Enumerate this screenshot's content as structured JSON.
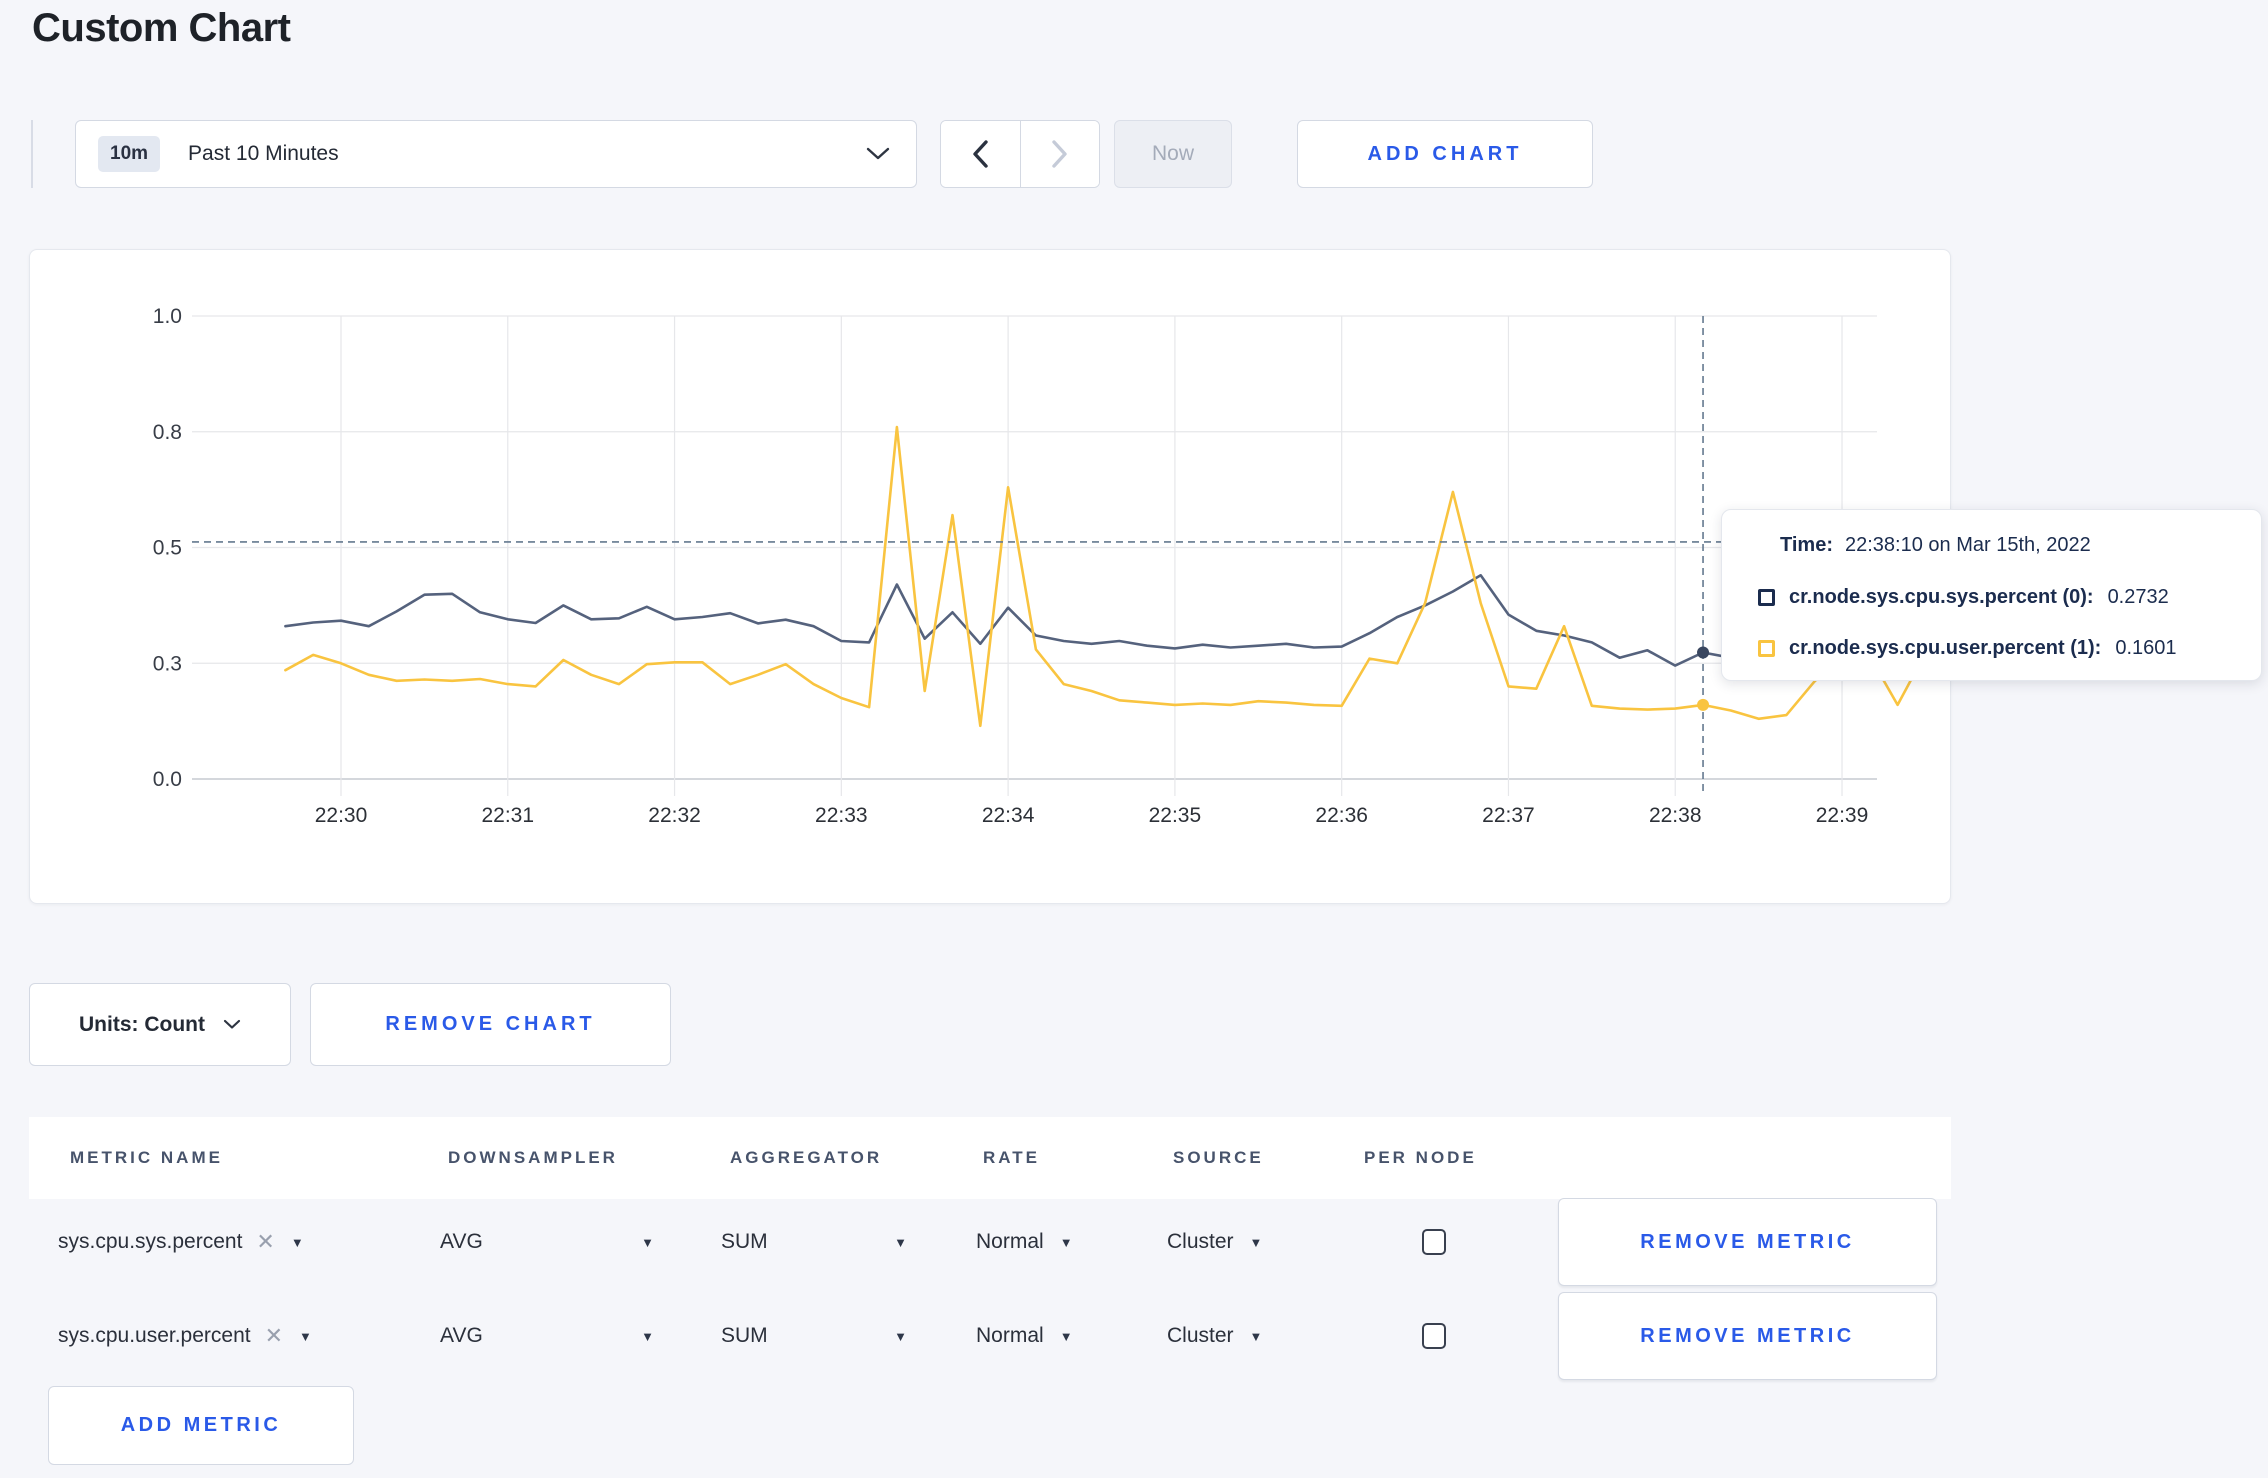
{
  "page": {
    "title": "Custom Chart",
    "accent_blue": "#2a5ae8",
    "background": "#f5f6fa"
  },
  "toolbar": {
    "time_badge": "10m",
    "time_label": "Past 10 Minutes",
    "prev_label": "previous time window",
    "next_label": "next time window",
    "now_label": "Now",
    "add_chart_label": "ADD CHART"
  },
  "chart_data": {
    "type": "line",
    "title": "",
    "xlabel": "",
    "ylabel": "",
    "ylim": [
      0,
      1
    ],
    "grid": true,
    "x_ticks": [
      "22:30",
      "22:31",
      "22:32",
      "22:33",
      "22:34",
      "22:35",
      "22:36",
      "22:37",
      "22:38",
      "22:39"
    ],
    "y_ticks": [
      {
        "value": 0.0,
        "label": "0.0"
      },
      {
        "value": 0.25,
        "label": "0.3"
      },
      {
        "value": 0.5,
        "label": "0.5"
      },
      {
        "value": 0.75,
        "label": "0.8"
      },
      {
        "value": 1.0,
        "label": "1.0"
      }
    ],
    "x_start_offset_sec": -20,
    "x_step_sec": 10,
    "series": [
      {
        "name": "cr.node.sys.cpu.sys.percent (0)",
        "color": "#55627d",
        "values": [
          0.33,
          0.338,
          0.342,
          0.33,
          0.362,
          0.398,
          0.4,
          0.36,
          0.345,
          0.337,
          0.375,
          0.345,
          0.347,
          0.372,
          0.345,
          0.35,
          0.358,
          0.336,
          0.344,
          0.33,
          0.298,
          0.295,
          0.42,
          0.303,
          0.36,
          0.292,
          0.37,
          0.31,
          0.298,
          0.292,
          0.298,
          0.288,
          0.282,
          0.29,
          0.284,
          0.288,
          0.292,
          0.284,
          0.286,
          0.315,
          0.35,
          0.375,
          0.405,
          0.44,
          0.355,
          0.32,
          0.31,
          0.295,
          0.262,
          0.278,
          0.245,
          0.2732,
          0.262,
          0.245,
          0.24,
          0.252,
          0.262,
          0.25,
          0.246,
          0.252
        ]
      },
      {
        "name": "cr.node.sys.cpu.user.percent (1)",
        "color": "#f9c440",
        "values": [
          0.235,
          0.268,
          0.25,
          0.225,
          0.212,
          0.215,
          0.212,
          0.216,
          0.205,
          0.2,
          0.257,
          0.225,
          0.205,
          0.248,
          0.252,
          0.252,
          0.205,
          0.225,
          0.248,
          0.205,
          0.175,
          0.155,
          0.76,
          0.19,
          0.57,
          0.115,
          0.63,
          0.28,
          0.205,
          0.19,
          0.17,
          0.165,
          0.16,
          0.163,
          0.16,
          0.168,
          0.165,
          0.16,
          0.158,
          0.26,
          0.25,
          0.38,
          0.62,
          0.38,
          0.2,
          0.195,
          0.33,
          0.158,
          0.152,
          0.15,
          0.152,
          0.1601,
          0.148,
          0.13,
          0.138,
          0.21,
          0.268,
          0.265,
          0.16,
          0.272
        ]
      }
    ],
    "crosshair": {
      "index": 51,
      "time": "22:38:10",
      "hline_value": 0.512,
      "color": "#64798f"
    },
    "legend_position": "tooltip"
  },
  "tooltip": {
    "time_label": "Time:",
    "time_value": "22:38:10 on Mar 15th, 2022",
    "rows": [
      {
        "label": "cr.node.sys.cpu.sys.percent (0):",
        "value": "0.2732",
        "color": "#1b2c4e"
      },
      {
        "label": "cr.node.sys.cpu.user.percent (1):",
        "value": "0.1601",
        "color": "#f9c440"
      }
    ]
  },
  "chart_footer": {
    "units_label": "Units: Count",
    "remove_chart_label": "REMOVE CHART"
  },
  "metrics_table": {
    "headers": [
      "METRIC NAME",
      "DOWNSAMPLER",
      "AGGREGATOR",
      "RATE",
      "SOURCE",
      "PER NODE"
    ],
    "rows": [
      {
        "metric": "sys.cpu.sys.percent",
        "downsampler": "AVG",
        "aggregator": "SUM",
        "rate": "Normal",
        "source": "Cluster",
        "per_node_checked": false,
        "remove_label": "REMOVE METRIC"
      },
      {
        "metric": "sys.cpu.user.percent",
        "downsampler": "AVG",
        "aggregator": "SUM",
        "rate": "Normal",
        "source": "Cluster",
        "per_node_checked": false,
        "remove_label": "REMOVE METRIC"
      }
    ],
    "add_metric_label": "ADD METRIC"
  }
}
